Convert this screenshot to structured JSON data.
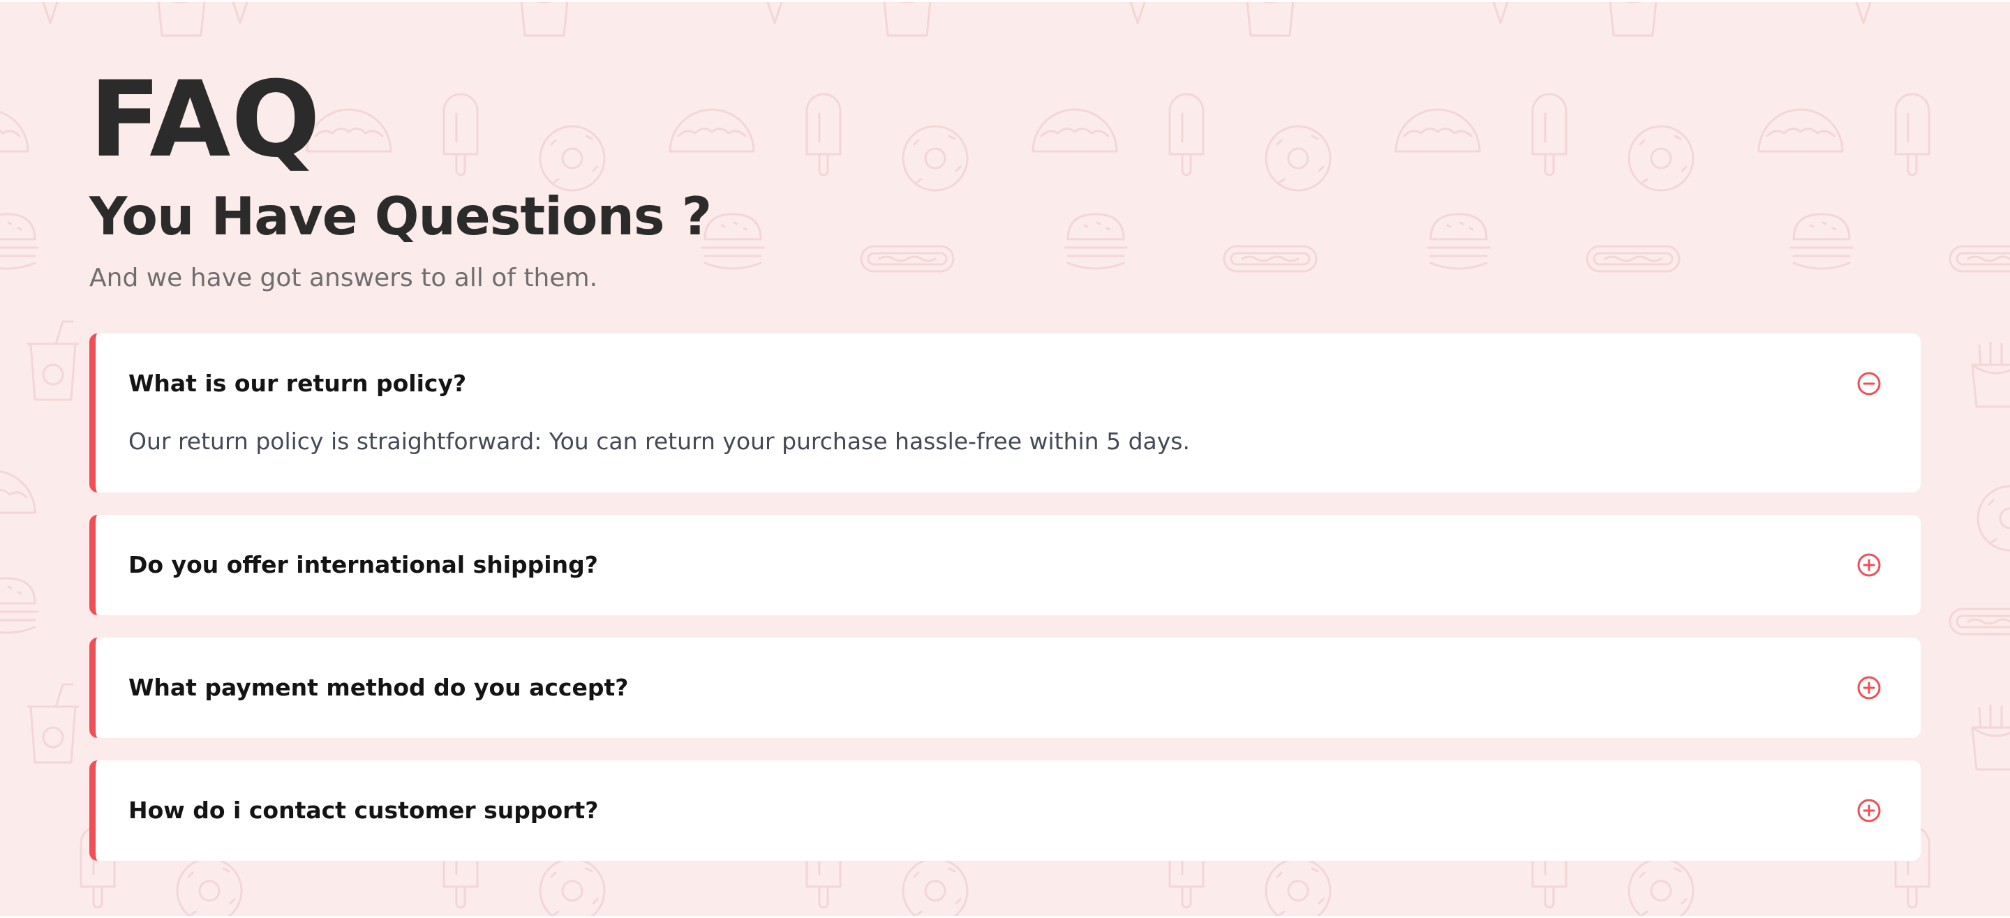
{
  "header": {
    "title": "FAQ",
    "subtitle": "You Have Questions ?",
    "lead": "And we have got answers to all of them."
  },
  "faq": {
    "items": [
      {
        "question": "What is our return policy?",
        "answer": "Our return policy is straightforward: You can return your purchase hassle-free within 5 days.",
        "expanded": true,
        "toggle_icon": "minus-circle-icon"
      },
      {
        "question": "Do you offer international shipping?",
        "expanded": false,
        "toggle_icon": "plus-circle-icon"
      },
      {
        "question": "What payment method do you accept?",
        "expanded": false,
        "toggle_icon": "plus-circle-icon"
      },
      {
        "question": "How do i contact customer support?",
        "expanded": false,
        "toggle_icon": "plus-circle-icon"
      }
    ]
  },
  "background": {
    "pattern_icons": [
      "fries-icon",
      "ice-cream-cone-icon",
      "burger-icon",
      "hot-dog-icon",
      "taco-icon",
      "popsicle-icon",
      "donut-icon",
      "soda-cup-icon"
    ]
  },
  "colors": {
    "accent": "#ef4f55",
    "page_background": "#fcebeb",
    "card_background": "#ffffff",
    "heading": "#2b2b2b",
    "muted_text": "#6e6e6e"
  }
}
